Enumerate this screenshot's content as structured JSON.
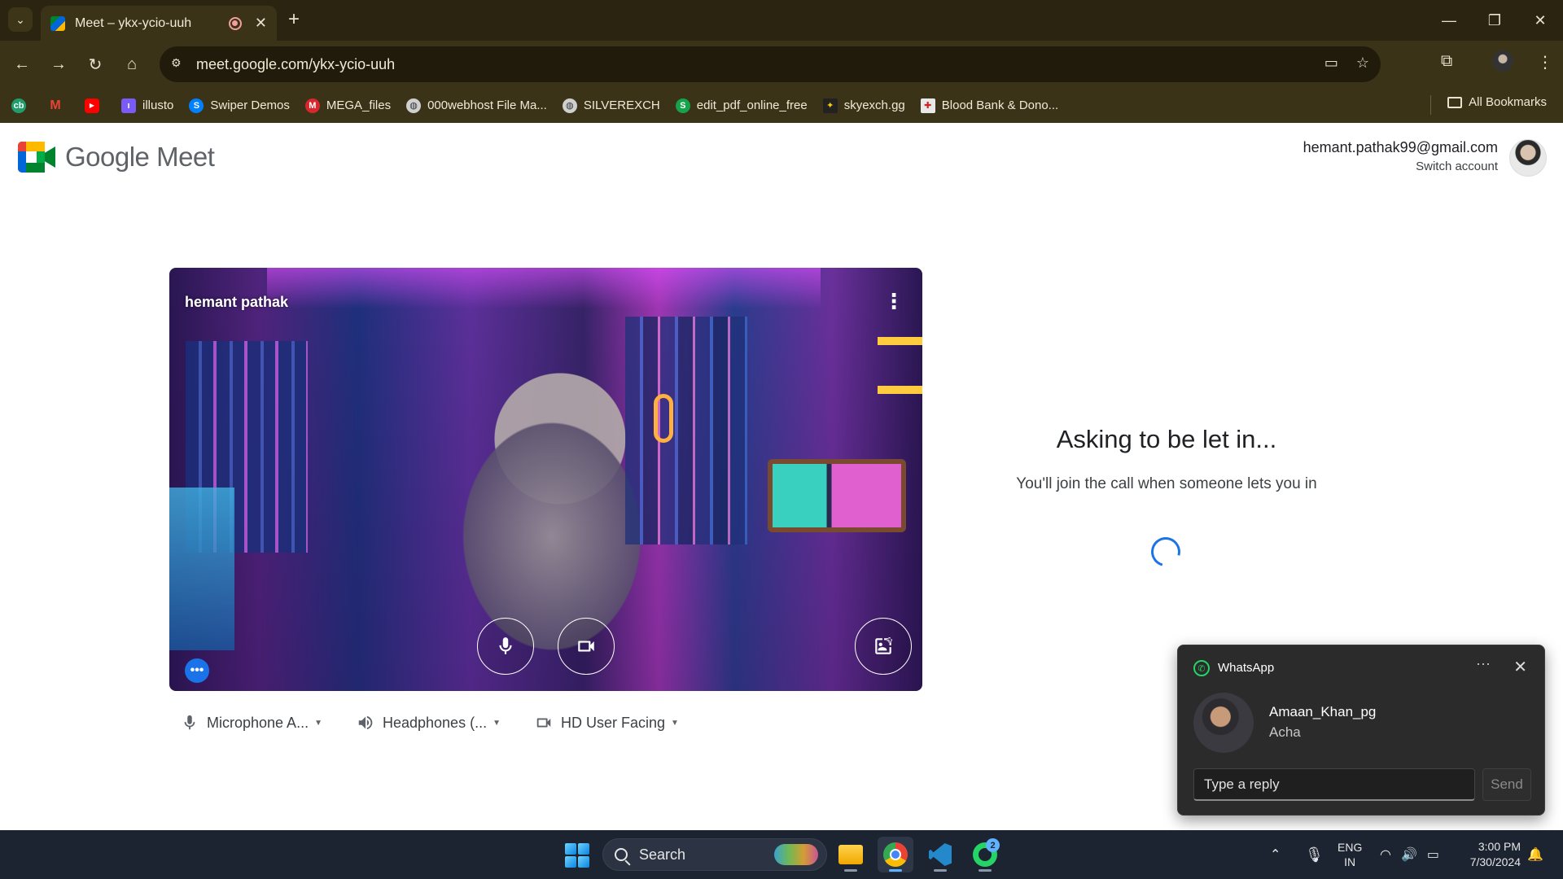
{
  "browser": {
    "tab_title": "Meet – ykx-ycio-uuh",
    "url": "meet.google.com/ykx-ycio-uuh",
    "bookmarks": [
      {
        "label": "",
        "icon": "codebeautify-icon",
        "color": "#1e9e6a"
      },
      {
        "label": "",
        "icon": "gmail-icon",
        "color": "#ea4335"
      },
      {
        "label": "",
        "icon": "youtube-icon",
        "color": "#ff0000"
      },
      {
        "label": "illusto",
        "icon": "illusto-icon",
        "color": "#7a5af8"
      },
      {
        "label": "Swiper Demos",
        "icon": "swiper-icon",
        "color": "#0080ff"
      },
      {
        "label": "MEGA_files",
        "icon": "mega-icon",
        "color": "#d9272e"
      },
      {
        "label": "000webhost File Ma...",
        "icon": "globe-icon",
        "color": "#cfcfcf"
      },
      {
        "label": "SILVEREXCH",
        "icon": "globe-icon",
        "color": "#cfcfcf"
      },
      {
        "label": "edit_pdf_online_free",
        "icon": "s-icon",
        "color": "#16a34a"
      },
      {
        "label": "skyexch.gg",
        "icon": "skyexch-icon",
        "color": "#222222"
      },
      {
        "label": "Blood Bank & Dono...",
        "icon": "bloodbank-icon",
        "color": "#e8e8e8"
      }
    ],
    "all_bookmarks_label": "All Bookmarks"
  },
  "meet": {
    "logo_text": "Google Meet",
    "account_email": "hemant.pathak99@gmail.com",
    "switch_account": "Switch account",
    "self_name": "hemant pathak",
    "devices": {
      "microphone": "Microphone A...",
      "speaker": "Headphones (...",
      "camera": "HD User Facing"
    },
    "status_title": "Asking to be let in...",
    "status_subtitle": "You'll join the call when someone lets you in"
  },
  "toast": {
    "app_name": "WhatsApp",
    "sender": "Amaan_Khan_pg",
    "message": "Acha",
    "reply_placeholder": "Type a reply",
    "send_label": "Send"
  },
  "taskbar": {
    "search_label": "Search",
    "whatsapp_badge": "2",
    "lang_line1": "ENG",
    "lang_line2": "IN",
    "time": "3:00 PM",
    "date": "7/30/2024"
  }
}
